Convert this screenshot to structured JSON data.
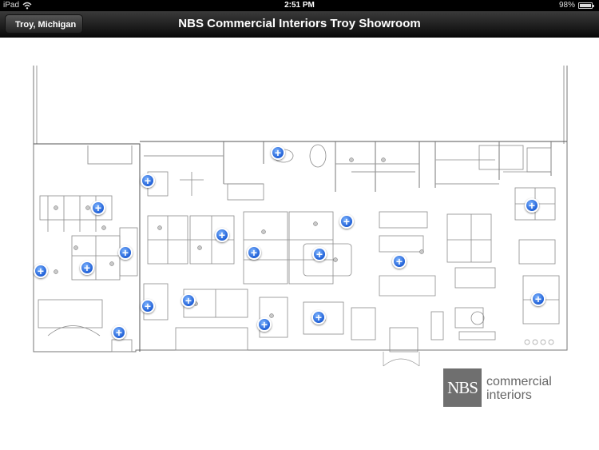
{
  "status_bar": {
    "carrier": "iPad",
    "time": "2:51 PM",
    "battery": "98%",
    "battery_level": 0.98
  },
  "nav": {
    "back_label": "Troy, Michigan",
    "title": "NBS Commercial Interiors Troy Showroom"
  },
  "map": {
    "pin_symbol": "+"
  },
  "logo": {
    "mark": "NBS",
    "line1": "commercial",
    "line2": "interiors"
  }
}
